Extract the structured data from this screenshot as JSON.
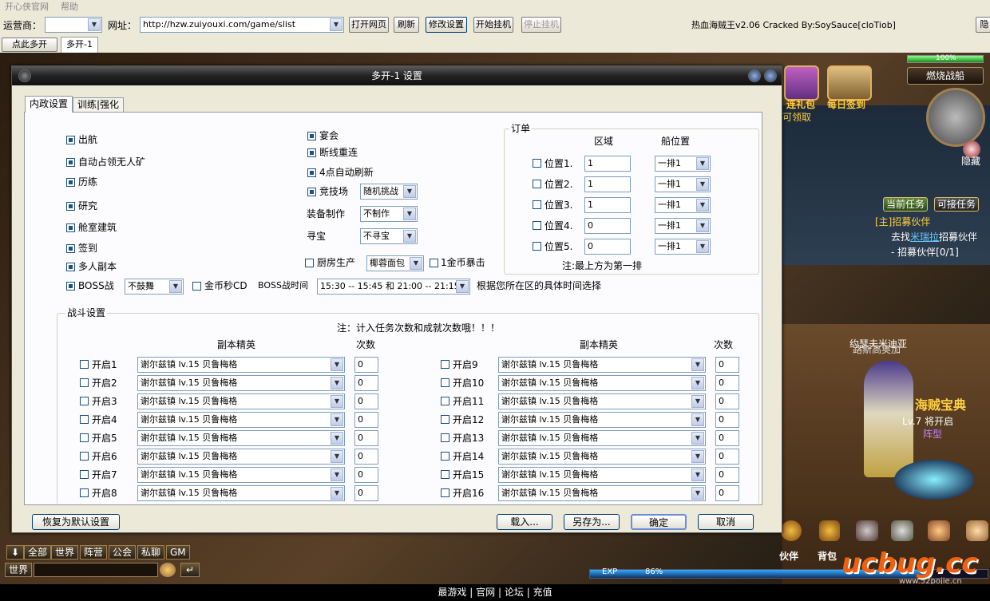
{
  "menu": {
    "items": [
      "开心侠官网",
      "帮助"
    ]
  },
  "toolbar": {
    "operator_label": "运营商：",
    "operator_value": "",
    "url_label": "网址：",
    "url_value": "http://hzw.zuiyouxi.com/game/slist",
    "btn_open": "打开网页",
    "btn_refresh": "刷新",
    "btn_settings": "修改设置",
    "btn_start": "开始挂机",
    "btn_stop": "停止挂机",
    "app_title": "热血海贼王v2.06 Cracked By:SoySauce[cloTiob]",
    "btn_hide": "隐藏"
  },
  "tabs": {
    "multi_open": "点此多开",
    "tab1": "多开-1"
  },
  "dialog": {
    "title": "多开-1 设置",
    "tab_domestic": "内政设置",
    "tab_training": "训练|强化",
    "left_checks": [
      {
        "label": "出航",
        "checked": true
      },
      {
        "label": "自动占领无人矿",
        "checked": true
      },
      {
        "label": "历练",
        "checked": true
      },
      {
        "label": "研究",
        "checked": true
      },
      {
        "label": "舱室建筑",
        "checked": true
      },
      {
        "label": "签到",
        "checked": true
      },
      {
        "label": "多人副本",
        "checked": true
      },
      {
        "label": "BOSS战",
        "checked": true
      }
    ],
    "boss_dance": "不鼓舞",
    "gold_cd_label": "金币秒CD",
    "boss_time_label": "BOSS战时间",
    "boss_time_value": "15:30 -- 15:45 和 21:00 -- 21:15",
    "boss_time_note": "根据您所在区的具体时间选择",
    "mid_checks": [
      {
        "label": "宴会",
        "checked": true
      },
      {
        "label": "断线重连",
        "checked": true
      },
      {
        "label": "4点自动刷新",
        "checked": true
      },
      {
        "label": "竞技场",
        "checked": true
      }
    ],
    "arena_value": "随机挑战",
    "equip_label": "装备制作",
    "equip_value": "不制作",
    "treasure_label": "寻宝",
    "treasure_value": "不寻宝",
    "kitchen_label": "厨房生产",
    "kitchen_value": "椰蓉面包",
    "gold_crit_label": "1金币暴击",
    "order": {
      "title": "订单",
      "col_area": "区域",
      "col_ship": "船位置",
      "rows": [
        {
          "label": "位置1.",
          "area": "1",
          "ship": "一排1"
        },
        {
          "label": "位置2.",
          "area": "1",
          "ship": "一排1"
        },
        {
          "label": "位置3.",
          "area": "1",
          "ship": "一排1"
        },
        {
          "label": "位置4.",
          "area": "0",
          "ship": "一排1"
        },
        {
          "label": "位置5.",
          "area": "0",
          "ship": "一排1"
        }
      ],
      "note": "注:最上方为第一排"
    },
    "battle": {
      "title": "战斗设置",
      "note": "注：计入任务次数和成就次数哦！！！",
      "col_dungeon": "副本精英",
      "col_count": "次数",
      "left_rows": [
        {
          "label": "开启1",
          "dungeon": "谢尔兹镇  lv.15 贝鲁梅格",
          "count": "0"
        },
        {
          "label": "开启2",
          "dungeon": "谢尔兹镇  lv.15 贝鲁梅格",
          "count": "0"
        },
        {
          "label": "开启3",
          "dungeon": "谢尔兹镇  lv.15 贝鲁梅格",
          "count": "0"
        },
        {
          "label": "开启4",
          "dungeon": "谢尔兹镇  lv.15 贝鲁梅格",
          "count": "0"
        },
        {
          "label": "开启5",
          "dungeon": "谢尔兹镇  lv.15 贝鲁梅格",
          "count": "0"
        },
        {
          "label": "开启6",
          "dungeon": "谢尔兹镇  lv.15 贝鲁梅格",
          "count": "0"
        },
        {
          "label": "开启7",
          "dungeon": "谢尔兹镇  lv.15 贝鲁梅格",
          "count": "0"
        },
        {
          "label": "开启8",
          "dungeon": "谢尔兹镇  lv.15 贝鲁梅格",
          "count": "0"
        }
      ],
      "right_rows": [
        {
          "label": "开启9",
          "dungeon": "谢尔兹镇  lv.15 贝鲁梅格",
          "count": "0"
        },
        {
          "label": "开启10",
          "dungeon": "谢尔兹镇  lv.15 贝鲁梅格",
          "count": "0"
        },
        {
          "label": "开启11",
          "dungeon": "谢尔兹镇  lv.15 贝鲁梅格",
          "count": "0"
        },
        {
          "label": "开启12",
          "dungeon": "谢尔兹镇  lv.15 贝鲁梅格",
          "count": "0"
        },
        {
          "label": "开启13",
          "dungeon": "谢尔兹镇  lv.15 贝鲁梅格",
          "count": "0"
        },
        {
          "label": "开启14",
          "dungeon": "谢尔兹镇  lv.15 贝鲁梅格",
          "count": "0"
        },
        {
          "label": "开启15",
          "dungeon": "谢尔兹镇  lv.15 贝鲁梅格",
          "count": "0"
        },
        {
          "label": "开启16",
          "dungeon": "谢尔兹镇  lv.15 贝鲁梅格",
          "count": "0"
        }
      ]
    },
    "btn_reset": "恢复为默认设置",
    "btn_load": "载入...",
    "btn_saveas": "另存为...",
    "btn_ok": "确定",
    "btn_cancel": "取消"
  },
  "game": {
    "hp_percent": "100%",
    "ship_name": "燃烧战船",
    "gift_label": "连礼包",
    "gift_sub": "可领取",
    "signin_label": "每日签到",
    "hide_label": "隐藏",
    "quest_tab_current": "当前任务",
    "quest_tab_available": "可接任务",
    "quest_title": "[主]招募伙伴",
    "quest_line1_pre": "去找",
    "quest_line1_npc": "米瑞拉",
    "quest_line1_post": "招募伙伴",
    "quest_line2": "- 招募伙伴[0/1]",
    "npc_name": "约瑟夫米迪亚",
    "npc_sub": "路斯高奥加",
    "treasure_title": "海贼宝典",
    "treasure_lv": "Lv.7  将开启",
    "treasure_sub": "阵型",
    "partner_label": "伙伴",
    "bag_label": "背包",
    "exp_label": "EXP",
    "exp_percent": "86%",
    "watermark": "ucbug.cc",
    "watermark_sub": "www.52pojie.cn",
    "chat_tabs": [
      "全部",
      "世界",
      "阵营",
      "公会",
      "私聊",
      "GM"
    ],
    "chat_channel": "世界"
  },
  "footer": {
    "links": [
      "最游戏",
      "官网",
      "论坛",
      "充值"
    ],
    "sep": "|"
  }
}
